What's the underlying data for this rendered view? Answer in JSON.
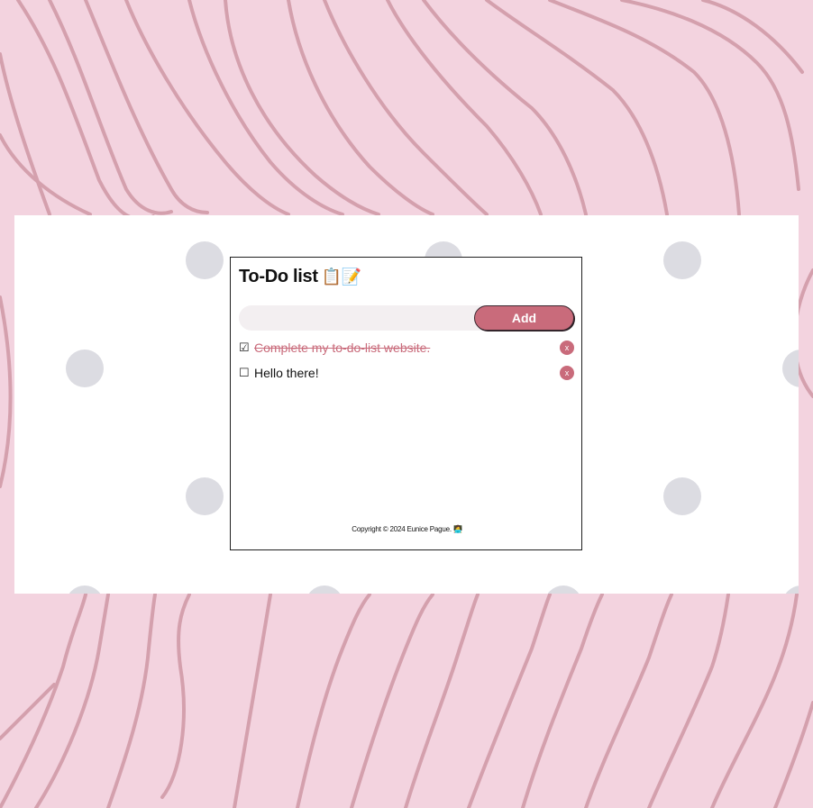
{
  "app": {
    "title": "To-Do list",
    "title_icons": "📋📝"
  },
  "form": {
    "input_value": "",
    "input_placeholder": "",
    "add_label": "Add"
  },
  "tasks": [
    {
      "label": "Complete my to-do-list website.",
      "checked": true,
      "checkbox": "☑",
      "delete_label": "x"
    },
    {
      "label": "Hello there!",
      "checked": false,
      "checkbox": "☐",
      "delete_label": "x"
    }
  ],
  "footer": {
    "text": "Copyright © 2024 Eunice Pague. 👩‍💻"
  },
  "colors": {
    "background": "#f3d3df",
    "wave": "#d4a0ad",
    "accent": "#c96b7b",
    "dot": "#dcdce2"
  }
}
